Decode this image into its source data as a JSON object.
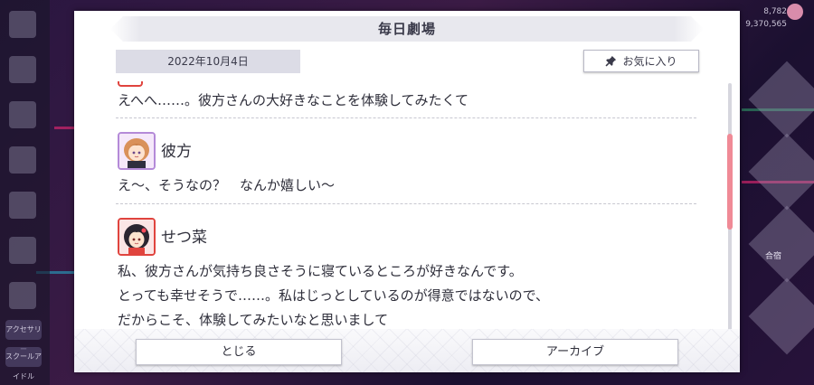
{
  "dialog": {
    "title": "毎日劇場",
    "date": "2022年10月4日",
    "favorite_label": "お気に入り"
  },
  "conversation": {
    "lines": [
      {
        "speaker": "",
        "text": "えへへ……。彼方さんの大好きなことを体験してみたくて"
      },
      {
        "speaker": "彼方",
        "text": "え～、そうなの？　なんか嬉しい～"
      },
      {
        "speaker": "せつ菜",
        "text_lines": [
          "私、彼方さんが気持ち良さそうに寝ているところが好きなんです。",
          "とっても幸せそうで……。私はじっとしているのが得意ではないので、",
          "だからこそ、体験してみたいなと思いまして"
        ]
      }
    ]
  },
  "footer": {
    "close_label": "とじる",
    "archive_label": "アーカイブ"
  },
  "background": {
    "counter_top": "8,782",
    "counter_bottom": "9,370,565",
    "right_label": "合宿",
    "side_labels": [
      "アクセサリー",
      "スクールアイドル"
    ]
  },
  "colors": {
    "accent_scroll": "#f08a96",
    "kanata_border": "#b48ad8",
    "setsuna_border": "#e0443e"
  },
  "icons": {
    "favorite": "pushpin-icon"
  }
}
